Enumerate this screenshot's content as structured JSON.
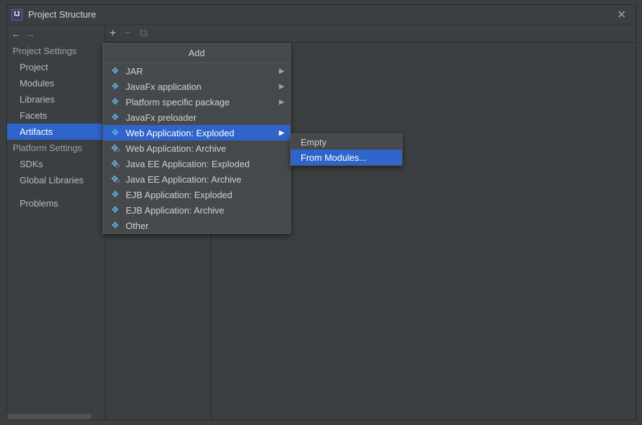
{
  "window": {
    "title": "Project Structure",
    "app_icon_glyph": "IJ"
  },
  "sidebar": {
    "section1_title": "Project Settings",
    "section1_items": [
      {
        "label": "Project",
        "selected": false
      },
      {
        "label": "Modules",
        "selected": false
      },
      {
        "label": "Libraries",
        "selected": false
      },
      {
        "label": "Facets",
        "selected": false
      },
      {
        "label": "Artifacts",
        "selected": true
      }
    ],
    "section2_title": "Platform Settings",
    "section2_items": [
      {
        "label": "SDKs",
        "selected": false
      },
      {
        "label": "Global Libraries",
        "selected": false
      }
    ],
    "problems_label": "Problems"
  },
  "toolbar": {
    "add_glyph": "+",
    "remove_glyph": "−",
    "copy_glyph": "⧉"
  },
  "add_menu": {
    "title": "Add",
    "items": [
      {
        "label": "JAR",
        "icon": "artifact",
        "has_submenu": true,
        "highlighted": false
      },
      {
        "label": "JavaFx application",
        "icon": "artifact",
        "has_submenu": true,
        "highlighted": false
      },
      {
        "label": "Platform specific package",
        "icon": "artifact",
        "has_submenu": true,
        "highlighted": false
      },
      {
        "label": "JavaFx preloader",
        "icon": "artifact",
        "has_submenu": false,
        "highlighted": false
      },
      {
        "label": "Web Application: Exploded",
        "icon": "artifact",
        "has_submenu": true,
        "highlighted": true
      },
      {
        "label": "Web Application: Archive",
        "icon": "archive",
        "has_submenu": false,
        "highlighted": false
      },
      {
        "label": "Java EE Application: Exploded",
        "icon": "archive",
        "has_submenu": false,
        "highlighted": false
      },
      {
        "label": "Java EE Application: Archive",
        "icon": "archive",
        "has_submenu": false,
        "highlighted": false
      },
      {
        "label": "EJB Application: Exploded",
        "icon": "artifact",
        "has_submenu": false,
        "highlighted": false
      },
      {
        "label": "EJB Application: Archive",
        "icon": "artifact",
        "has_submenu": false,
        "highlighted": false
      },
      {
        "label": "Other",
        "icon": "artifact",
        "has_submenu": false,
        "highlighted": false
      }
    ]
  },
  "submenu": {
    "items": [
      {
        "label": "Empty",
        "highlighted": false
      },
      {
        "label": "From Modules...",
        "highlighted": true
      }
    ]
  }
}
